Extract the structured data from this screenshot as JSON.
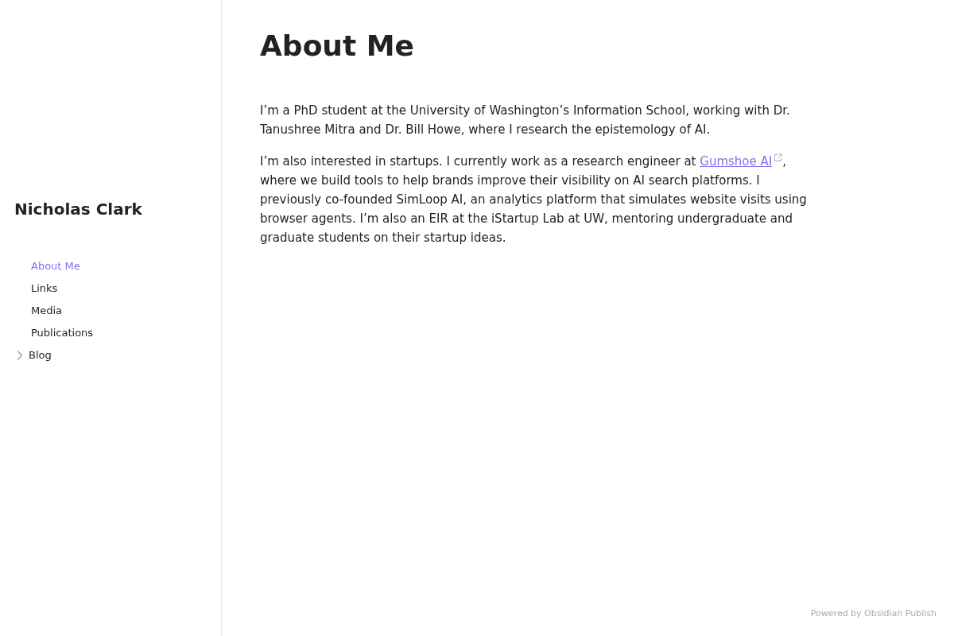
{
  "sidebar": {
    "site_name": "Nicholas Clark",
    "nav": [
      {
        "kind": "page",
        "label": "About Me",
        "selected": true
      },
      {
        "kind": "page",
        "label": "Links",
        "selected": false
      },
      {
        "kind": "page",
        "label": "Media",
        "selected": false
      },
      {
        "kind": "page",
        "label": "Publications",
        "selected": false
      },
      {
        "kind": "folder",
        "label": "Blog",
        "selected": false,
        "expanded": false
      }
    ]
  },
  "page": {
    "title": "About Me",
    "paragraphs": [
      {
        "parts": [
          {
            "kind": "text",
            "text": "I’m a PhD student at the University of Washington’s Information School, working with Dr. Tanushree Mitra and Dr. Bill Howe, where I research the epistemology of AI."
          }
        ]
      },
      {
        "parts": [
          {
            "kind": "text",
            "text": "I’m also interested in startups. I currently work as a research engineer at "
          },
          {
            "kind": "link",
            "text": "Gumshoe AI",
            "external": true
          },
          {
            "kind": "text",
            "text": ", where we build tools to help brands improve their visibility on AI search platforms. I previously co-founded SimLoop AI, an analytics platform that simulates website visits using browser agents. I’m also an EIR at the iStartup Lab at UW, mentoring undergraduate and graduate students on their startup ideas."
          }
        ]
      }
    ]
  },
  "footer": {
    "text": "Powered by Obsidian Publish"
  }
}
